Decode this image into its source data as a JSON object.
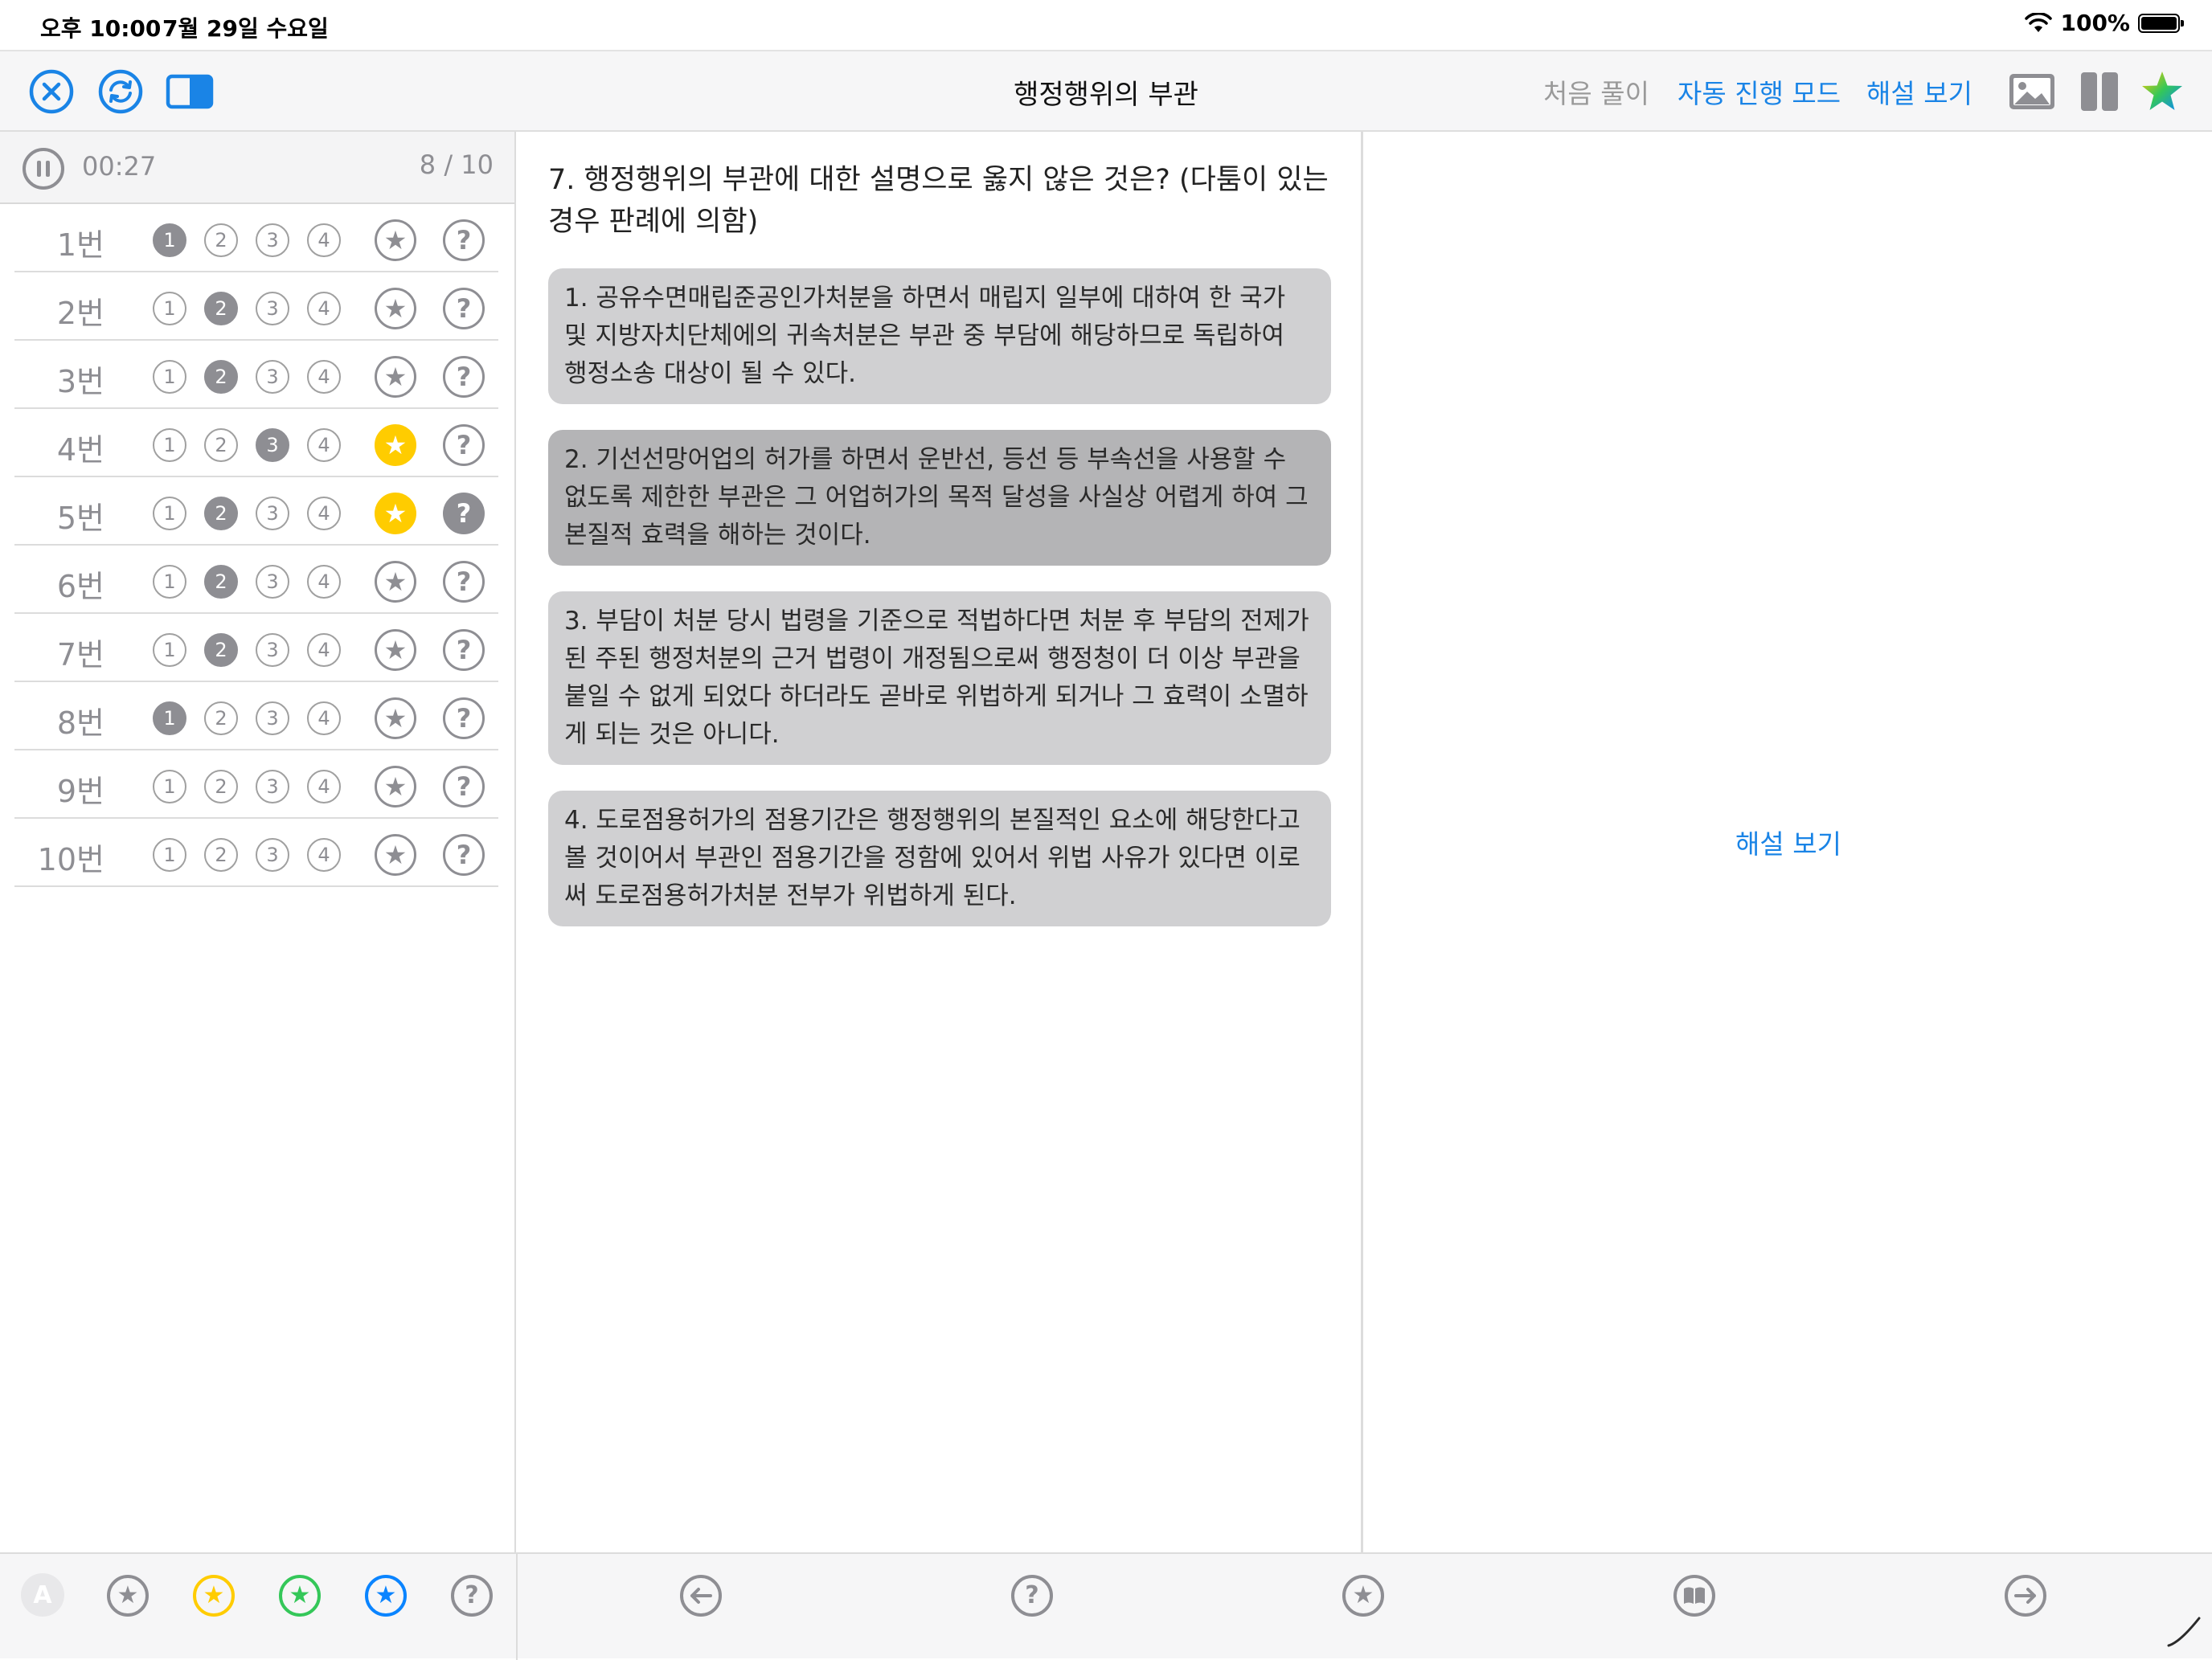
{
  "status_bar": {
    "time": "오후 10:00",
    "date": "7월 29일 수요일",
    "battery": "100%"
  },
  "toolbar": {
    "title": "행정행위의 부관",
    "restart_label": "처음 풀이",
    "auto_mode_label": "자동 진행 모드",
    "show_explanation_label": "해설 보기"
  },
  "sidebar": {
    "timer": "00:27",
    "progress": "8 / 10",
    "questions": [
      {
        "label": "1번",
        "selected": 1,
        "starred": false,
        "unsure": false
      },
      {
        "label": "2번",
        "selected": 2,
        "starred": false,
        "unsure": false
      },
      {
        "label": "3번",
        "selected": 2,
        "starred": false,
        "unsure": false
      },
      {
        "label": "4번",
        "selected": 3,
        "starred": true,
        "unsure": false
      },
      {
        "label": "5번",
        "selected": 2,
        "starred": true,
        "unsure": true
      },
      {
        "label": "6번",
        "selected": 2,
        "starred": false,
        "unsure": false
      },
      {
        "label": "7번",
        "selected": 2,
        "starred": false,
        "unsure": false
      },
      {
        "label": "8번",
        "selected": 1,
        "starred": false,
        "unsure": false
      },
      {
        "label": "9번",
        "selected": 0,
        "starred": false,
        "unsure": false
      },
      {
        "label": "10번",
        "selected": 0,
        "starred": false,
        "unsure": false
      }
    ],
    "option_labels": [
      "1",
      "2",
      "3",
      "4"
    ]
  },
  "main": {
    "question": "7. 행정행위의 부관에 대한 설명으로 옳지 않은 것은? (다툼이 있는 경우 판례에 의함)",
    "choices": [
      "1. 공유수면매립준공인가처분을 하면서 매립지 일부에 대하여 한 국가 및 지방자치단체에의 귀속처분은 부관 중 부담에 해당하므로 독립하여 행정소송 대상이 될 수 있다.",
      "2. 기선선망어업의 허가를 하면서 운반선, 등선 등 부속선을 사용할 수 없도록 제한한 부관은 그 어업허가의 목적 달성을 사실상 어렵게 하여 그 본질적 효력을 해하는 것이다.",
      "3. 부담이 처분 당시 법령을 기준으로 적법하다면 처분 후 부담의 전제가 된 주된 행정처분의 근거 법령이 개정됨으로써 행정청이 더 이상 부관을 붙일 수 없게 되었다 하더라도 곧바로 위법하게 되거나 그 효력이 소멸하게 되는 것은 아니다.",
      "4. 도로점용허가의 점용기간은 행정행위의 본질적인 요소에 해당한다고 볼 것이어서 부관인 점용기간을 정함에 있어서 위법 사유가 있다면 이로써 도로점용허가처분 전부가 위법하게 된다."
    ],
    "selected_choice_index": 1
  },
  "right": {
    "show_explanation_label": "해설 보기"
  },
  "bottom": {
    "filter_all_label": "A"
  },
  "colors": {
    "accent": "#1a84e6",
    "star_yellow": "#ffcc00",
    "star_green": "#34c759",
    "star_blue": "#0a84ff",
    "gray": "#8e8e93"
  }
}
